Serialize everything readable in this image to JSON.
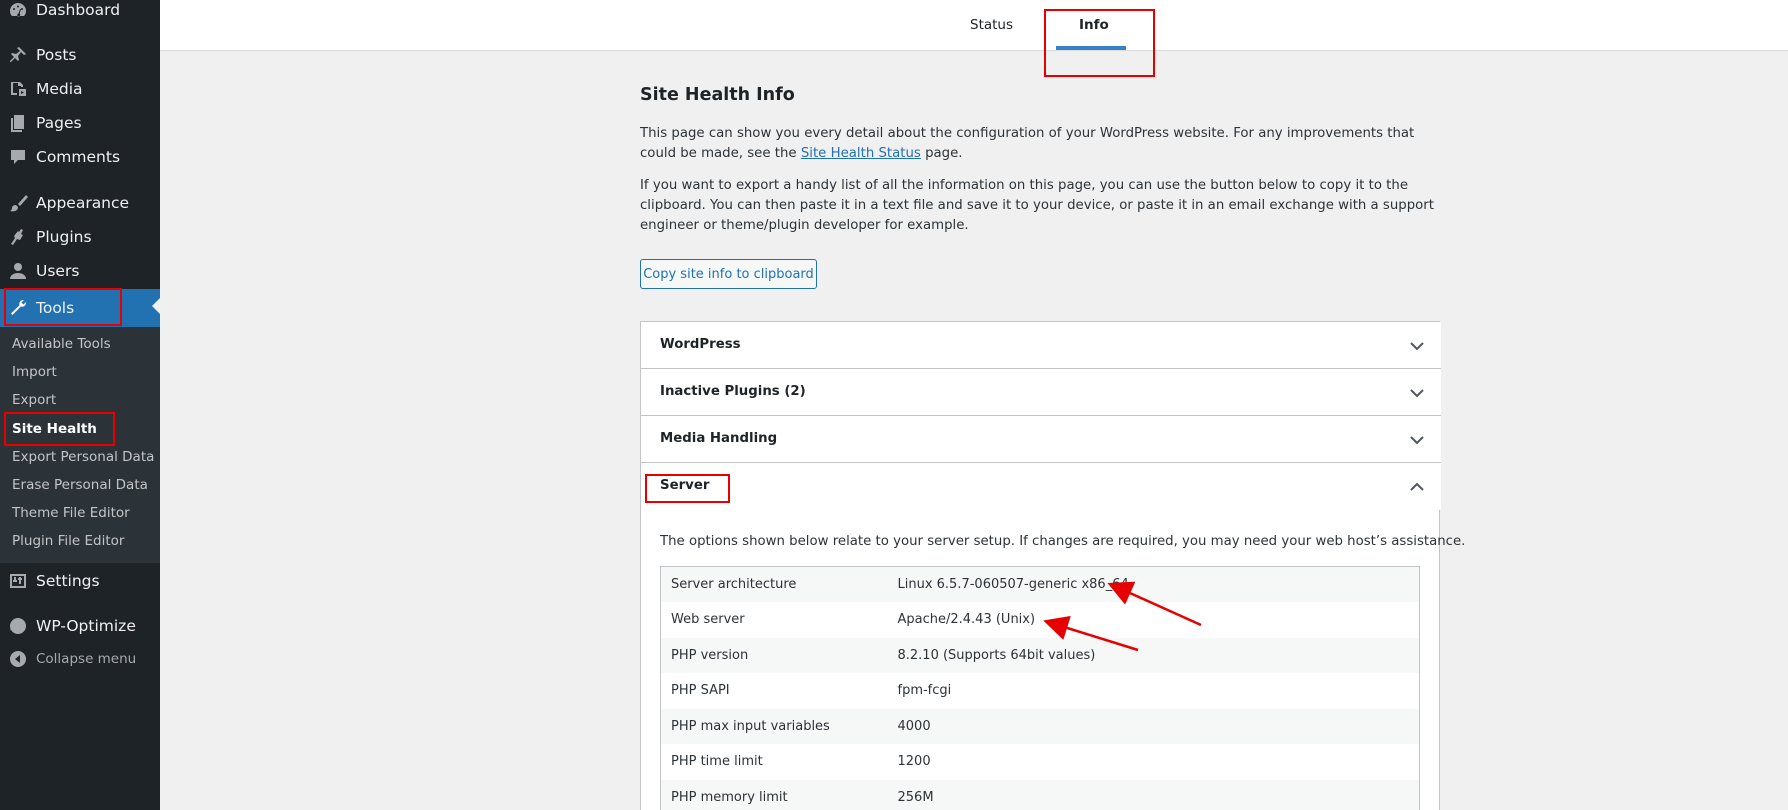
{
  "sidebar": {
    "items": [
      {
        "label": "Dashboard",
        "icon": "dashboard-icon"
      },
      {
        "label": "Posts",
        "icon": "pin-icon"
      },
      {
        "label": "Media",
        "icon": "media-icon"
      },
      {
        "label": "Pages",
        "icon": "pages-icon"
      },
      {
        "label": "Comments",
        "icon": "comment-icon"
      },
      {
        "label": "Appearance",
        "icon": "brush-icon"
      },
      {
        "label": "Plugins",
        "icon": "plug-icon"
      },
      {
        "label": "Users",
        "icon": "user-icon"
      },
      {
        "label": "Tools",
        "icon": "wrench-icon"
      },
      {
        "label": "Settings",
        "icon": "settings-icon"
      },
      {
        "label": "WP-Optimize",
        "icon": "optimize-icon"
      }
    ],
    "submenu": [
      {
        "label": "Available Tools"
      },
      {
        "label": "Import"
      },
      {
        "label": "Export"
      },
      {
        "label": "Site Health"
      },
      {
        "label": "Export Personal Data"
      },
      {
        "label": "Erase Personal Data"
      },
      {
        "label": "Theme File Editor"
      },
      {
        "label": "Plugin File Editor"
      }
    ],
    "collapse_label": "Collapse menu",
    "active_color": "#2271b1"
  },
  "tabs": {
    "status": "Status",
    "info": "Info"
  },
  "page": {
    "title": "Site Health Info",
    "intro_1_pre": "This page can show you every detail about the configuration of your WordPress website. For any improvements that could be made, see the ",
    "intro_1_link": "Site Health Status",
    "intro_1_post": " page.",
    "intro_2": "If you want to export a handy list of all the information on this page, you can use the button below to copy it to the clipboard. You can then paste it in a text file and save it to your device, or paste it in an email exchange with a support engineer or theme/plugin developer for example.",
    "copy_button": "Copy site info to clipboard"
  },
  "sections": [
    {
      "label": "WordPress",
      "expanded": false
    },
    {
      "label": "Inactive Plugins (2)",
      "expanded": false
    },
    {
      "label": "Media Handling",
      "expanded": false
    },
    {
      "label": "Server",
      "expanded": true
    }
  ],
  "server": {
    "description": "The options shown below relate to your server setup. If changes are required, you may need your web host’s assistance.",
    "rows": [
      {
        "key": "Server architecture",
        "value": "Linux 6.5.7-060507-generic x86_64"
      },
      {
        "key": "Web server",
        "value": "Apache/2.4.43 (Unix)"
      },
      {
        "key": "PHP version",
        "value": "8.2.10 (Supports 64bit values)"
      },
      {
        "key": "PHP SAPI",
        "value": "fpm-fcgi"
      },
      {
        "key": "PHP max input variables",
        "value": "4000"
      },
      {
        "key": "PHP time limit",
        "value": "1200"
      },
      {
        "key": "PHP memory limit",
        "value": "256M"
      }
    ]
  },
  "annotation_color": "#e60000"
}
